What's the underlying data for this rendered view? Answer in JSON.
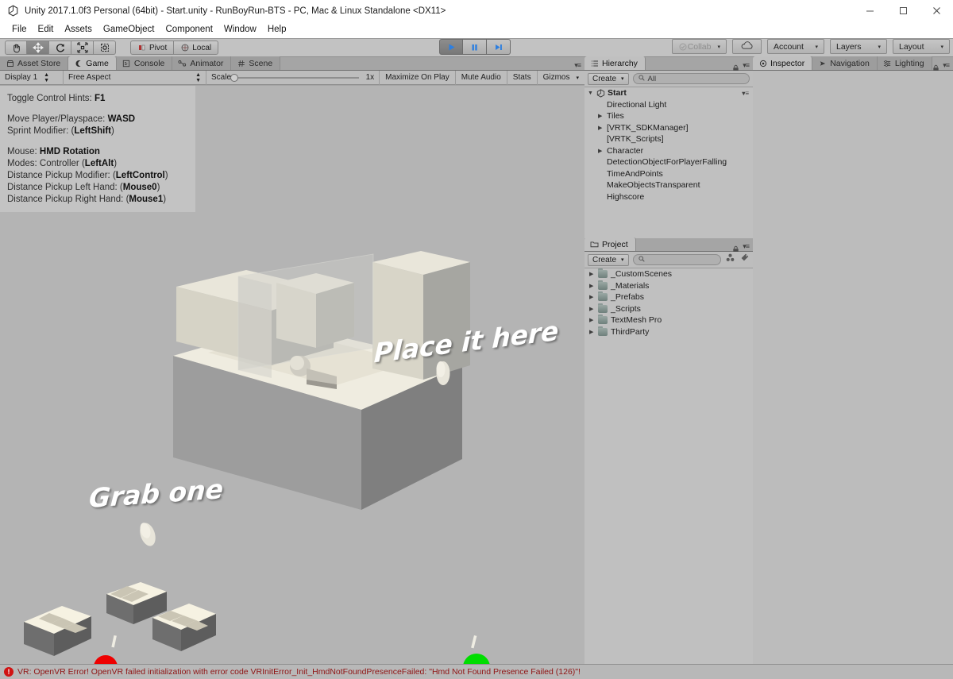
{
  "window": {
    "title": "Unity 2017.1.0f3 Personal (64bit) - Start.unity - RunBoyRun-BTS - PC, Mac & Linux Standalone <DX11>",
    "app_icon": "unity-logo-icon",
    "controls": {
      "minimize": "minimize-icon",
      "maximize": "maximize-icon",
      "close": "close-icon"
    }
  },
  "menubar": {
    "items": [
      {
        "label": "File"
      },
      {
        "label": "Edit"
      },
      {
        "label": "Assets"
      },
      {
        "label": "GameObject"
      },
      {
        "label": "Component"
      },
      {
        "label": "Window"
      },
      {
        "label": "Help"
      }
    ]
  },
  "toolbar": {
    "transform_tools": [
      {
        "name": "hand-tool",
        "icon": "hand-icon",
        "selected": false
      },
      {
        "name": "move-tool",
        "icon": "move-arrows-icon",
        "selected": true
      },
      {
        "name": "rotate-tool",
        "icon": "rotate-icon",
        "selected": false
      },
      {
        "name": "scale-tool",
        "icon": "scale-icon",
        "selected": false
      },
      {
        "name": "rect-tool",
        "icon": "rect-transform-icon",
        "selected": false
      }
    ],
    "pivot_label": "Pivot",
    "local_label": "Local",
    "play_label": "play-icon",
    "pause_label": "pause-icon",
    "step_label": "step-icon",
    "collab_label": "Collab",
    "cloud_label": "cloud-icon",
    "account_label": "Account",
    "layers_label": "Layers",
    "layout_label": "Layout",
    "caret": "▾"
  },
  "game_panel": {
    "tabs": [
      {
        "label": "Asset Store",
        "icon": "store-icon",
        "active": false
      },
      {
        "label": "Game",
        "icon": "game-icon",
        "active": true
      },
      {
        "label": "Console",
        "icon": "console-icon",
        "active": false
      },
      {
        "label": "Animator",
        "icon": "animator-icon",
        "active": false
      },
      {
        "label": "Scene",
        "icon": "scene-grid-icon",
        "active": false
      }
    ],
    "display": "Display 1",
    "aspect": "Free Aspect",
    "scale_label": "Scale",
    "scale_value": "1x",
    "maximize_on_play": "Maximize On Play",
    "mute_audio": "Mute Audio",
    "stats": "Stats",
    "gizmos": "Gizmos"
  },
  "hints": {
    "lines": [
      {
        "text": "Toggle Control Hints: ",
        "bold": "F1"
      },
      {
        "spacer": true
      },
      {
        "text": "Move Player/Playspace: ",
        "bold": "WASD"
      },
      {
        "text": "Sprint Modifier: (",
        "bold": "LeftShift",
        "tail": ")"
      },
      {
        "spacer": true
      },
      {
        "text": "Mouse: ",
        "bold": "HMD Rotation"
      },
      {
        "text": "Modes: Controller (",
        "bold": "LeftAlt",
        "tail": ")"
      },
      {
        "text": "Distance Pickup Modifier: (",
        "bold": "LeftControl",
        "tail": ")"
      },
      {
        "text": "Distance Pickup Left Hand: (",
        "bold": "Mouse0",
        "tail": ")"
      },
      {
        "text": "Distance Pickup Right Hand: (",
        "bold": "Mouse1",
        "tail": ")"
      }
    ]
  },
  "scene_labels": {
    "grab_one": "Grab one",
    "place_it_here": "Place it here"
  },
  "hierarchy": {
    "tab_label": "Hierarchy",
    "tab_icon": "hierarchy-icon",
    "create_label": "Create",
    "search_placeholder": "All",
    "scene_name": "Start",
    "items": [
      {
        "label": "Directional Light",
        "expandable": false
      },
      {
        "label": "Tiles",
        "expandable": true
      },
      {
        "label": "[VRTK_SDKManager]",
        "expandable": true
      },
      {
        "label": "[VRTK_Scripts]",
        "expandable": false
      },
      {
        "label": "Character",
        "expandable": true
      },
      {
        "label": "DetectionObjectForPlayerFalling",
        "expandable": false
      },
      {
        "label": "TimeAndPoints",
        "expandable": false
      },
      {
        "label": "MakeObjectsTransparent",
        "expandable": false
      },
      {
        "label": "Highscore",
        "expandable": false
      }
    ]
  },
  "project": {
    "tab_label": "Project",
    "tab_icon": "folder-icon",
    "create_label": "Create",
    "search_placeholder": "",
    "folders": [
      {
        "label": "_CustomScenes"
      },
      {
        "label": "_Materials"
      },
      {
        "label": "_Prefabs"
      },
      {
        "label": "_Scripts"
      },
      {
        "label": "TextMesh Pro"
      },
      {
        "label": "ThirdParty"
      }
    ]
  },
  "inspector": {
    "tabs": [
      {
        "label": "Inspector",
        "icon": "inspector-icon",
        "active": true
      },
      {
        "label": "Navigation",
        "icon": "navigation-icon",
        "active": false
      },
      {
        "label": "Lighting",
        "icon": "lighting-icon",
        "active": false
      }
    ]
  },
  "statusbar": {
    "icon": "error-icon",
    "message": "VR: OpenVR Error! OpenVR failed initialization with error code VRInitError_Init_HmdNotFoundPresenceFailed: \"Hmd Not Found Presence Failed (126)\"!"
  },
  "colors": {
    "error_red": "#8f1414",
    "accent_blue": "#2d7fe0",
    "sphere_red": "#ee0000",
    "sphere_green": "#00dd00",
    "panel_gray": "#c0c0c0",
    "viewport_gray": "#b4b4b4"
  }
}
